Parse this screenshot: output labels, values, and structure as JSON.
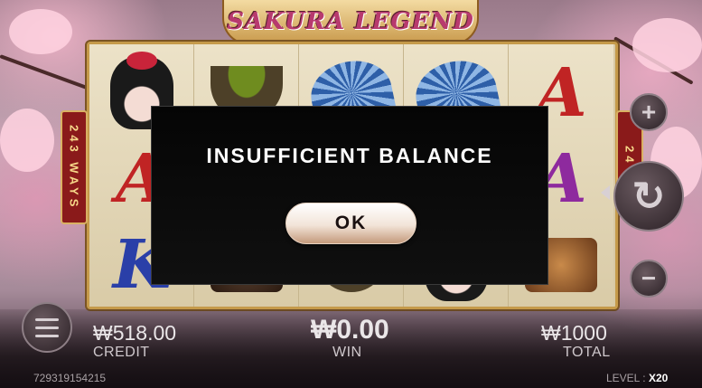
{
  "game": {
    "title": "SAKURA LEGEND"
  },
  "reels": {
    "ways_label": "243 WAYS",
    "ways_label_right": "24"
  },
  "symbols": {
    "letter_a": "A",
    "letter_k": "K"
  },
  "controls": {
    "plus_icon": "plus-icon",
    "minus_icon": "minus-icon",
    "spin_icon": "refresh-icon",
    "menu_icon": "hamburger-menu-icon",
    "plus_symbol": "+",
    "minus_symbol": "−",
    "spin_symbol": "↻"
  },
  "stats": {
    "credit_value": "₩518.00",
    "credit_label": "CREDIT",
    "win_value": "₩0.00",
    "win_label": "WIN",
    "total_value": "₩1000",
    "total_label": "TOTAL"
  },
  "footer": {
    "session_id": "729319154215",
    "level_label": "LEVEL :",
    "level_value": "X20"
  },
  "modal": {
    "message": "INSUFFICIENT BALANCE",
    "ok_label": "OK"
  },
  "colors": {
    "modal_bg": "#050505",
    "title_pink": "#b83a6e",
    "frame_gold": "#c59a4a",
    "ways_red": "#8a1a1a"
  }
}
